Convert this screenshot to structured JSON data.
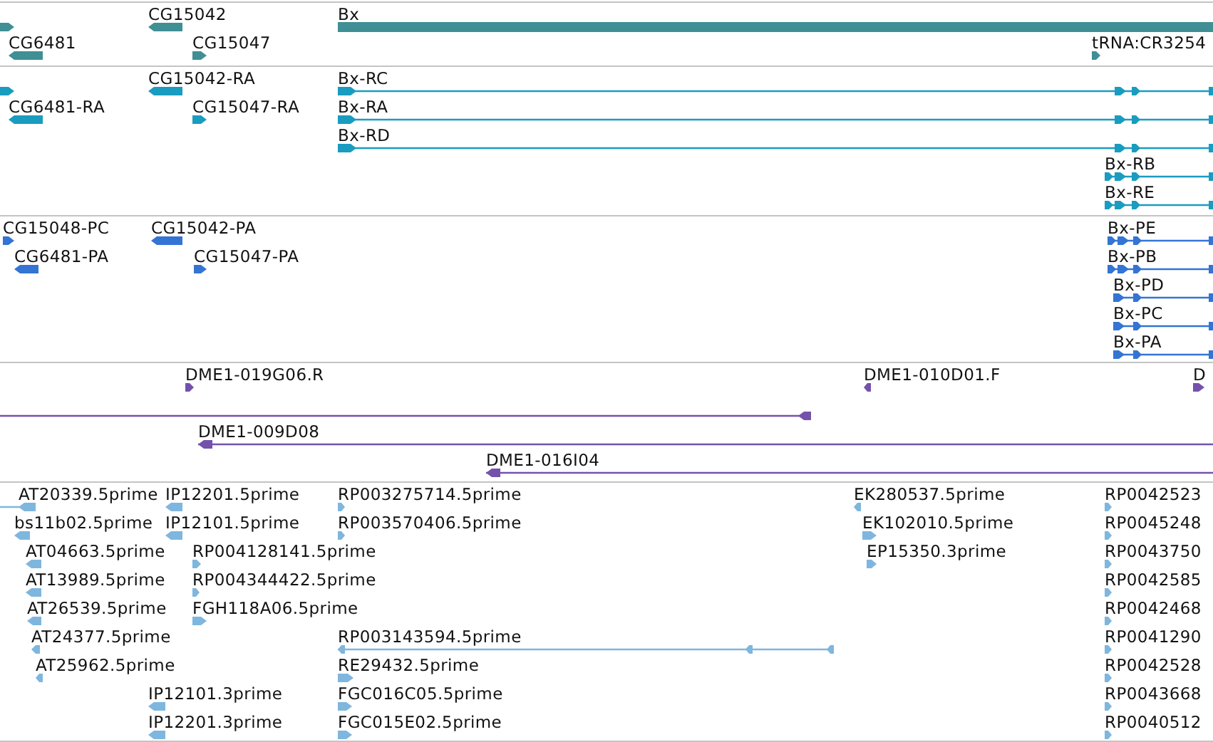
{
  "tracks": [
    {
      "color": "#3f8f94",
      "features": [
        {
          "kind": "block",
          "reverse": false
        },
        {
          "label": "CG15042",
          "kind": "block",
          "reverse": true
        },
        {
          "label": "Bx",
          "kind": "block",
          "reverse": false
        },
        {
          "label": "CG6481",
          "kind": "block",
          "reverse": true
        },
        {
          "label": "CG15047",
          "kind": "block",
          "reverse": false
        },
        {
          "label": "tRNA:CR3254",
          "kind": "block",
          "reverse": false
        }
      ]
    },
    {
      "color": "#1a9cc0",
      "features": [
        {
          "kind": "block",
          "reverse": false
        },
        {
          "label": "CG15042-RA",
          "kind": "block",
          "reverse": true
        },
        {
          "label": "Bx-RC",
          "kind": "transcript",
          "reverse": false
        },
        {
          "label": "CG6481-RA",
          "kind": "block",
          "reverse": true
        },
        {
          "label": "CG15047-RA",
          "kind": "block",
          "reverse": false
        },
        {
          "label": "Bx-RA",
          "kind": "transcript",
          "reverse": false
        },
        {
          "label": "Bx-RD",
          "kind": "transcript",
          "reverse": false
        },
        {
          "label": "Bx-RB",
          "kind": "transcript",
          "reverse": false
        },
        {
          "label": "Bx-RE",
          "kind": "transcript",
          "reverse": false
        }
      ]
    },
    {
      "color": "#3474d4",
      "features": [
        {
          "label": "CG15048-PC",
          "kind": "block",
          "reverse": false
        },
        {
          "label": "CG15042-PA",
          "kind": "block",
          "reverse": true
        },
        {
          "label": "Bx-PE",
          "kind": "transcript",
          "reverse": false
        },
        {
          "label": "CG6481-PA",
          "kind": "block",
          "reverse": true
        },
        {
          "label": "CG15047-PA",
          "kind": "block",
          "reverse": false
        },
        {
          "label": "Bx-PB",
          "kind": "transcript",
          "reverse": false
        },
        {
          "label": "Bx-PD",
          "kind": "transcript",
          "reverse": false
        },
        {
          "label": "Bx-PC",
          "kind": "transcript",
          "reverse": false
        },
        {
          "label": "Bx-PA",
          "kind": "transcript",
          "reverse": false
        }
      ]
    },
    {
      "color": "#7452ac",
      "features": [
        {
          "label": "DME1-019G06.R",
          "kind": "block",
          "reverse": false
        },
        {
          "label": "DME1-010D01.F",
          "kind": "block",
          "reverse": true
        },
        {
          "label": "D",
          "kind": "block",
          "reverse": false
        },
        {
          "kind": "transcript",
          "reverse": true
        },
        {
          "label": "DME1-009D08",
          "kind": "transcript",
          "reverse": true
        },
        {
          "label": "DME1-016I04",
          "kind": "transcript",
          "reverse": true
        }
      ]
    },
    {
      "color": "#7fb6de",
      "features": [
        {
          "label": "AT20339.5prime",
          "kind": "transcript",
          "reverse": true
        },
        {
          "label": "IP12201.5prime",
          "kind": "block",
          "reverse": true
        },
        {
          "label": "RP003275714.5prime",
          "kind": "block",
          "reverse": false
        },
        {
          "label": "EK280537.5prime",
          "kind": "block",
          "reverse": true
        },
        {
          "label": "RP0042523",
          "kind": "block",
          "reverse": false
        },
        {
          "label": "bs11b02.5prime",
          "kind": "block",
          "reverse": true
        },
        {
          "label": "IP12101.5prime",
          "kind": "block",
          "reverse": true
        },
        {
          "label": "RP003570406.5prime",
          "kind": "block",
          "reverse": false
        },
        {
          "label": "EK102010.5prime",
          "kind": "block",
          "reverse": false
        },
        {
          "label": "RP0045248",
          "kind": "block",
          "reverse": false
        },
        {
          "label": "AT04663.5prime",
          "kind": "block",
          "reverse": true
        },
        {
          "label": "RP004128141.5prime",
          "kind": "block",
          "reverse": false
        },
        {
          "label": "EP15350.3prime",
          "kind": "block",
          "reverse": false
        },
        {
          "label": "RP0043750",
          "kind": "block",
          "reverse": false
        },
        {
          "label": "AT13989.5prime",
          "kind": "block",
          "reverse": true
        },
        {
          "label": "RP004344422.5prime",
          "kind": "block",
          "reverse": false
        },
        {
          "label": "RP0042585",
          "kind": "block",
          "reverse": false
        },
        {
          "label": "AT26539.5prime",
          "kind": "block",
          "reverse": true
        },
        {
          "label": "FGH118A06.5prime",
          "kind": "block",
          "reverse": false
        },
        {
          "label": "RP0042468",
          "kind": "block",
          "reverse": false
        },
        {
          "label": "AT24377.5prime",
          "kind": "block",
          "reverse": true
        },
        {
          "label": "RP003143594.5prime",
          "kind": "transcript",
          "reverse": true
        },
        {
          "label": "RP0041290",
          "kind": "block",
          "reverse": false
        },
        {
          "label": "AT25962.5prime",
          "kind": "block",
          "reverse": true
        },
        {
          "label": "RE29432.5prime",
          "kind": "block",
          "reverse": false
        },
        {
          "label": "RP0042528",
          "kind": "block",
          "reverse": false
        },
        {
          "label": "IP12101.3prime",
          "kind": "block",
          "reverse": true
        },
        {
          "label": "FGC016C05.5prime",
          "kind": "block",
          "reverse": false
        },
        {
          "label": "RP0043668",
          "kind": "block",
          "reverse": false
        },
        {
          "label": "IP12201.3prime",
          "kind": "block",
          "reverse": true
        },
        {
          "label": "FGC015E02.5prime",
          "kind": "block",
          "reverse": false
        },
        {
          "label": "RP0040512",
          "kind": "block",
          "reverse": false
        }
      ]
    }
  ]
}
